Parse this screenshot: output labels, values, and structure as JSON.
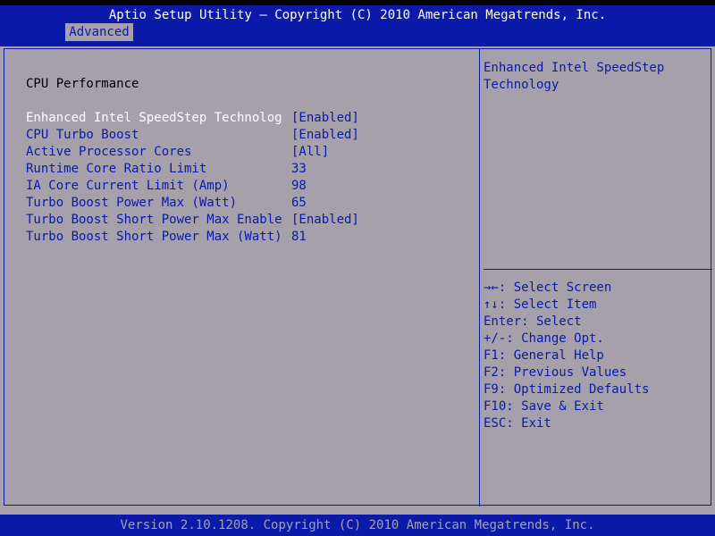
{
  "header": {
    "title": "Aptio Setup Utility – Copyright (C) 2010 American Megatrends, Inc.",
    "tabs": [
      {
        "label": "Advanced"
      }
    ]
  },
  "main": {
    "section_title": "CPU Performance",
    "settings": [
      {
        "label": "Enhanced Intel SpeedStep Technolog",
        "value": "[Enabled]"
      },
      {
        "label": "CPU Turbo Boost",
        "value": "[Enabled]"
      },
      {
        "label": "Active Processor Cores",
        "value": "[All]"
      },
      {
        "label": "Runtime Core Ratio Limit",
        "value": "33"
      },
      {
        "label": "IA Core Current Limit (Amp)",
        "value": "98"
      },
      {
        "label": "Turbo Boost Power Max (Watt)",
        "value": "65"
      },
      {
        "label": "Turbo Boost Short Power Max Enable",
        "value": "[Enabled]"
      },
      {
        "label": "Turbo Boost Short Power Max (Watt)",
        "value": "81"
      }
    ]
  },
  "help": {
    "text": "Enhanced Intel SpeedStep Technology"
  },
  "keys": [
    {
      "text": "→←: Select Screen"
    },
    {
      "text": "↑↓: Select Item"
    },
    {
      "text": "Enter: Select"
    },
    {
      "text": "+/-: Change Opt."
    },
    {
      "text": "F1: General Help"
    },
    {
      "text": "F2: Previous Values"
    },
    {
      "text": "F9: Optimized Defaults"
    },
    {
      "text": "F10: Save & Exit"
    },
    {
      "text": "ESC: Exit"
    }
  ],
  "footer": {
    "text": "Version 2.10.1208. Copyright (C) 2010 American Megatrends, Inc."
  },
  "colors": {
    "bios_blue": "#0b1aa8",
    "bios_gray": "#a5a0aa",
    "selected_text": "#ffffff"
  }
}
